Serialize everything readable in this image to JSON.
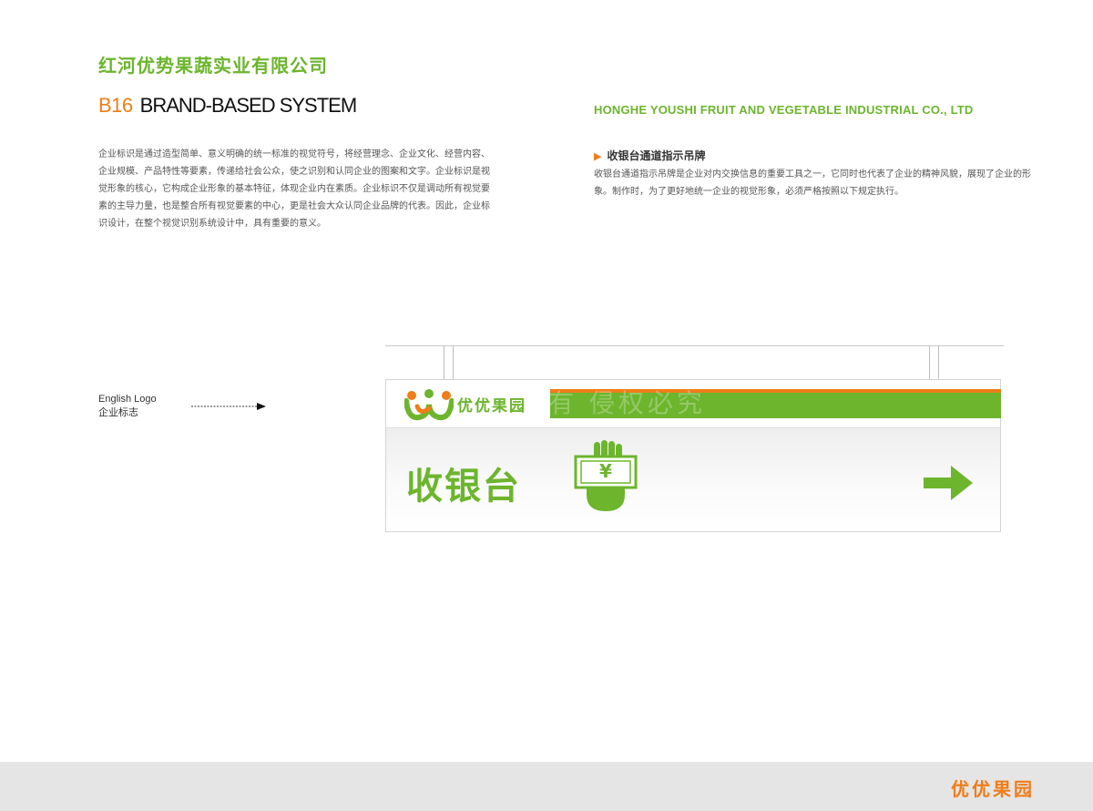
{
  "header": {
    "company_cn": "红河优势果蔬实业有限公司",
    "code": "B16",
    "system_title": "BRAND-BASED SYSTEM",
    "company_en": "HONGHE YOUSHI FRUIT AND VEGETABLE INDUSTRIAL CO., LTD"
  },
  "intro_text": "企业标识是通过造型简单、意义明确的统一标准的视觉符号，将经营理念、企业文化、经营内容、企业规模、产品特性等要素，传递给社会公众，使之识别和认同企业的图案和文字。企业标识是视觉形象的核心，它构成企业形象的基本特征，体现企业内在素质。企业标识不仅是调动所有视觉要素的主导力量，也是整合所有视觉要素的中心，更是社会大众认同企业品牌的代表。因此，企业标识设计，在整个视觉识别系统设计中，具有重要的意义。",
  "section": {
    "title": "收银台通道指示吊牌",
    "description": "收银台通道指示吊牌是企业对内交换信息的重要工具之一，它同时也代表了企业的精神风貌，展现了企业的形象。制作时，为了更好地统一企业的视觉形象，必须严格按照以下规定执行。"
  },
  "callout": {
    "label_en": "English Logo",
    "label_cn": "企业标志"
  },
  "sign": {
    "brand_name": "优优果园",
    "watermark": "有 侵权必究",
    "cashier_label": "收银台",
    "currency_symbol": "¥"
  },
  "footer": {
    "brand_name": "优优果园"
  },
  "colors": {
    "brand_green": "#6cb52d",
    "brand_orange": "#ef7d19",
    "footer_gray": "#e5e5e5"
  },
  "icons": [
    "triangle-bullet-icon",
    "dashed-arrow-icon",
    "logo-mark-icon",
    "cash-hand-icon",
    "right-arrow-icon"
  ]
}
